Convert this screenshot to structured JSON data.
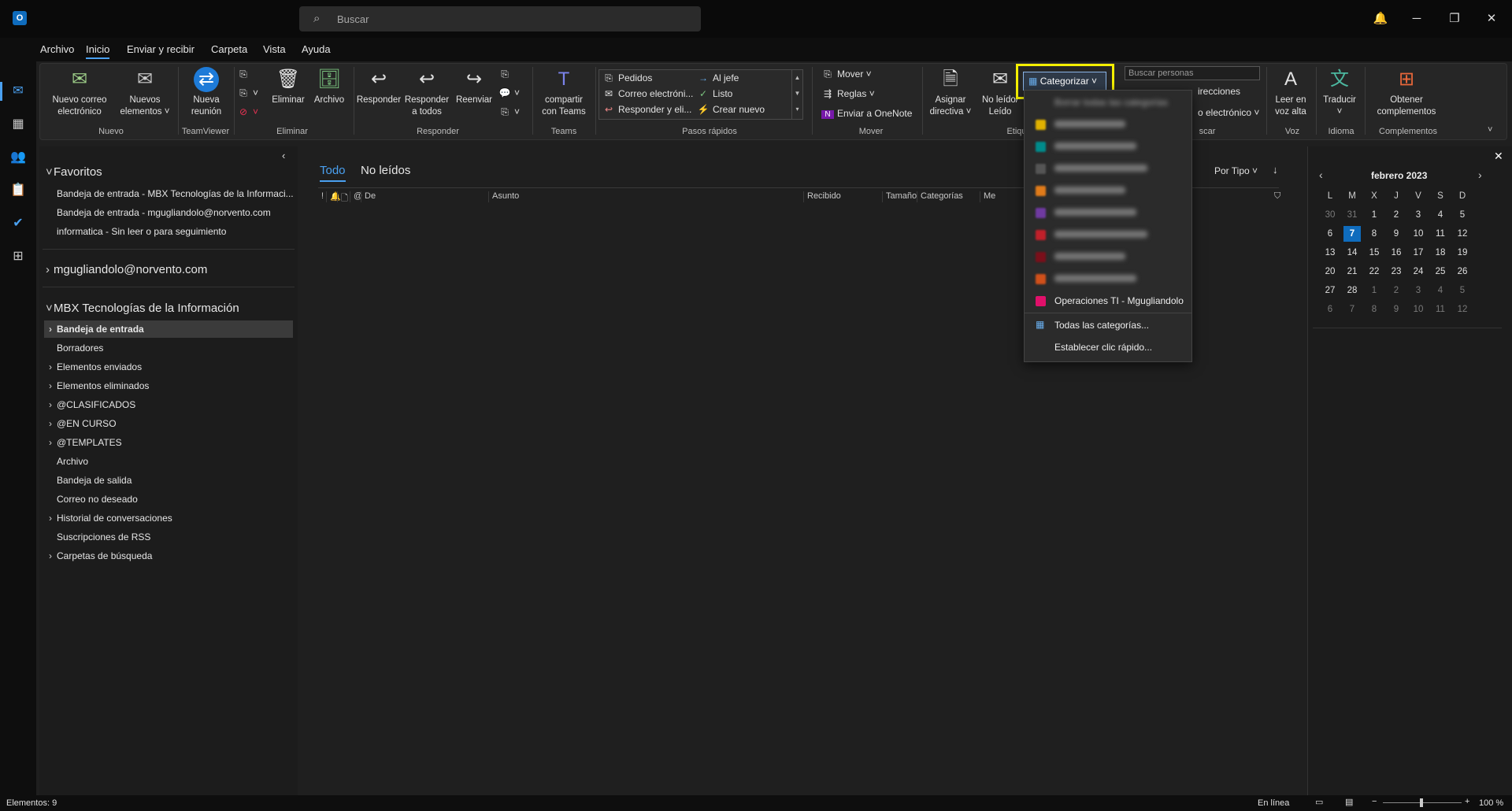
{
  "titlebar": {
    "search_placeholder": "Buscar",
    "app_icon_letter": "O"
  },
  "menu_tabs": [
    "Archivo",
    "Inicio",
    "Enviar y recibir",
    "Carpeta",
    "Vista",
    "Ayuda"
  ],
  "ribbon": {
    "nuevo_correo": [
      "Nuevo correo",
      "electrónico"
    ],
    "nuevos_elementos": [
      "Nuevos",
      "elementos ˅"
    ],
    "nueva_reunion": [
      "Nueva",
      "reunión"
    ],
    "eliminar": "Eliminar",
    "archivo": "Archivo",
    "responder": "Responder",
    "responder_todos": [
      "Responder",
      "a todos"
    ],
    "reenviar": "Reenviar",
    "compartir_teams": [
      "compartir",
      "con Teams"
    ],
    "quick_steps": [
      "Pedidos",
      "Correo electróni...",
      "Responder y eli...",
      "Al jefe",
      "Listo",
      "Crear nuevo"
    ],
    "mover": "Mover ˅",
    "reglas": "Reglas ˅",
    "onenote": "Enviar a OneNote",
    "asignar_directiva": [
      "Asignar",
      "directiva ˅"
    ],
    "no_leido": [
      "No leído/",
      "Leído"
    ],
    "categorizar": "Categorizar ˅",
    "buscar_personas": "Buscar personas",
    "direcciones": "irecciones",
    "correo_electronico": "o electrónico ˅",
    "leer_voz": [
      "Leer en",
      "voz alta"
    ],
    "traducir": [
      "Traducir",
      "˅"
    ],
    "obtener_complementos": [
      "Obtener",
      "complementos"
    ],
    "groups": {
      "nuevo": "Nuevo",
      "teamviewer": "TeamViewer",
      "eliminar": "Eliminar",
      "responder": "Responder",
      "teams": "Teams",
      "pasos": "Pasos rápidos",
      "mover": "Mover",
      "etiq": "Etiqu",
      "scar": "scar",
      "voz": "Voz",
      "idioma": "Idioma",
      "complementos": "Complementos"
    }
  },
  "folder_pane": {
    "favoritos": "Favoritos",
    "fav_items": [
      "Bandeja de entrada - MBX Tecnologías de la Informaci...",
      "Bandeja de entrada - mgugliandolo@norvento.com",
      "informatica - Sin leer o para seguimiento"
    ],
    "account1": "mgugliandolo@norvento.com",
    "account2": "MBX Tecnologías de la Información",
    "folders": [
      {
        "label": "Bandeja de entrada",
        "chev": true,
        "selected": true
      },
      {
        "label": "Borradores",
        "chev": false
      },
      {
        "label": "Elementos enviados",
        "chev": true
      },
      {
        "label": "Elementos eliminados",
        "chev": true
      },
      {
        "label": "@CLASIFICADOS",
        "chev": true
      },
      {
        "label": "@EN CURSO",
        "chev": true
      },
      {
        "label": "@TEMPLATES",
        "chev": true
      },
      {
        "label": "Archivo",
        "chev": false
      },
      {
        "label": "Bandeja de salida",
        "chev": false
      },
      {
        "label": "Correo no deseado",
        "chev": false
      },
      {
        "label": "Historial de conversaciones",
        "chev": true
      },
      {
        "label": "Suscripciones de RSS",
        "chev": false
      },
      {
        "label": "Carpetas de búsqueda",
        "chev": true
      }
    ]
  },
  "message_list": {
    "tabs": [
      "Todo",
      "No leídos"
    ],
    "sort": "Por Tipo ˅",
    "columns": [
      "!",
      "De",
      "Asunto",
      "Recibido",
      "Tamaño",
      "Categorías",
      "Me"
    ]
  },
  "calendar": {
    "month": "febrero 2023",
    "weekdays": [
      "L",
      "M",
      "X",
      "J",
      "V",
      "S",
      "D"
    ],
    "weeks": [
      [
        "30",
        "31",
        "1",
        "2",
        "3",
        "4",
        "5"
      ],
      [
        "6",
        "7",
        "8",
        "9",
        "10",
        "11",
        "12"
      ],
      [
        "13",
        "14",
        "15",
        "16",
        "17",
        "18",
        "19"
      ],
      [
        "20",
        "21",
        "22",
        "23",
        "24",
        "25",
        "26"
      ],
      [
        "27",
        "28",
        "1",
        "2",
        "3",
        "4",
        "5"
      ],
      [
        "6",
        "7",
        "8",
        "9",
        "10",
        "11",
        "12"
      ]
    ],
    "today": "7"
  },
  "dropdown": {
    "clear": "Borrar todas las categorías",
    "blurred_colors": [
      "#e0b100",
      "#008b8b",
      "#555555",
      "#e07b1a",
      "#6f3aa0",
      "#c0202a",
      "#7a0f1a",
      "#d0501a"
    ],
    "visible_category": "Operaciones TI - Mgugliandolo",
    "visible_color": "#e0106a",
    "all_categories": "Todas las categorías...",
    "quick_click": "Establecer clic rápido..."
  },
  "status": {
    "items": "Elementos: 9",
    "online": "En línea",
    "zoom": "100 %"
  }
}
